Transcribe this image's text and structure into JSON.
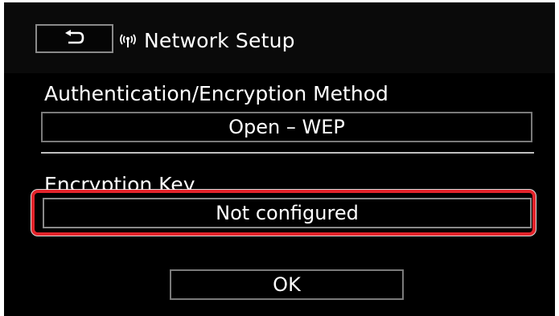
{
  "header": {
    "back_icon": "return-arrow-icon",
    "status_icon": "wireless-antenna-icon",
    "title": "Network Setup"
  },
  "auth": {
    "label": "Authentication/Encryption Method",
    "value": "Open – WEP"
  },
  "key": {
    "label": "Encryption Key",
    "value": "Not configured",
    "highlight_color": "#e3242b"
  },
  "actions": {
    "ok_label": "OK"
  }
}
